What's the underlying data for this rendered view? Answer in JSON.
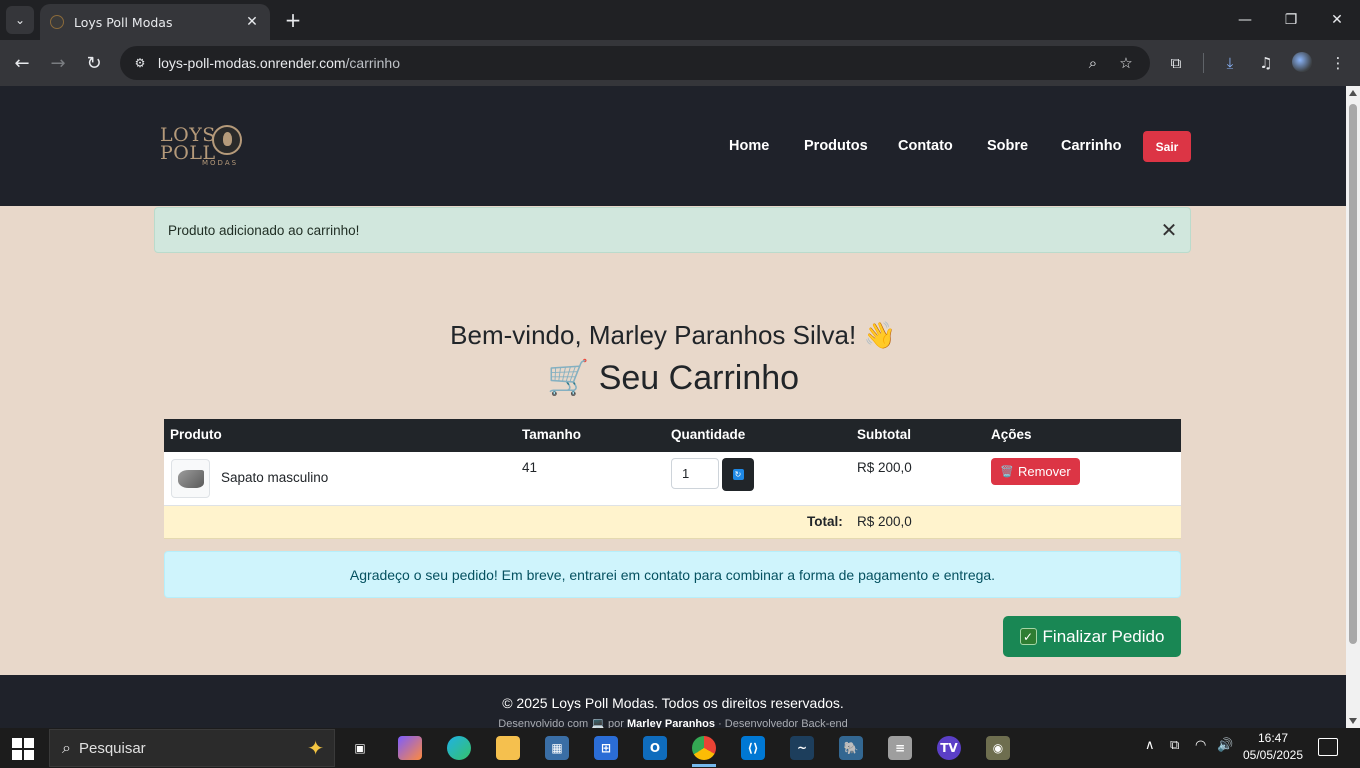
{
  "browser": {
    "tab_title": "Loys Poll Modas",
    "url_host": "loys-poll-modas.onrender.com",
    "url_path": "/carrinho"
  },
  "header": {
    "logo_line1": "LOYS",
    "logo_line2": "POLL",
    "logo_line3": "MODAS",
    "nav": [
      "Home",
      "Produtos",
      "Contato",
      "Sobre",
      "Carrinho"
    ],
    "logout_label": "Sair"
  },
  "alert_success": {
    "message": "Produto adicionado ao carrinho!",
    "close": "✕"
  },
  "welcome": "Bem-vindo, Marley Paranhos Silva! 👋",
  "cart_title": "🛒 Seu Carrinho",
  "table": {
    "headers": [
      "Produto",
      "Tamanho",
      "Quantidade",
      "Subtotal",
      "Ações"
    ],
    "rows": [
      {
        "product": "Sapato masculino",
        "size": "41",
        "quantity": "1",
        "subtotal": "R$ 200,0",
        "remove_label": "Remover",
        "remove_icon": "🗑️"
      }
    ],
    "total_label": "Total:",
    "total_value": "R$ 200,0"
  },
  "alert_info": {
    "message": "Agradeço o seu pedido! Em breve, entrarei em contato para combinar a forma de pagamento e entrega."
  },
  "finalize_label": "Finalizar Pedido",
  "footer": {
    "copyright": "© 2025 Loys Poll Modas. Todos os direitos reservados.",
    "dev_prefix": "Desenvolvido com 💻 por",
    "dev_name": "Marley Paranhos",
    "dev_suffix": "· Desenvolvedor Back-end"
  },
  "taskbar": {
    "search_placeholder": "Pesquisar",
    "time": "16:47",
    "date": "05/05/2025"
  },
  "colors": {
    "header_bg": "#1f222a",
    "page_bg": "#e8d8ca",
    "danger": "#dc3545",
    "success": "#198754"
  }
}
